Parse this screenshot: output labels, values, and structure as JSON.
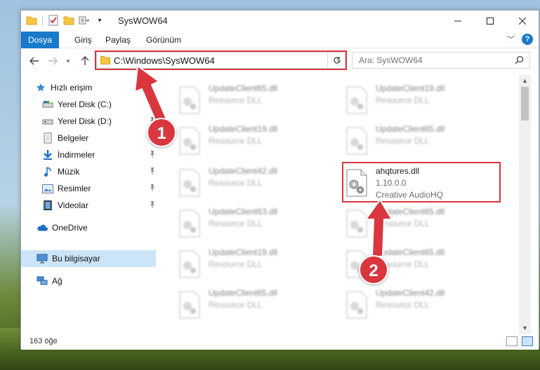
{
  "window": {
    "title": "SysWOW64"
  },
  "title_bar": {
    "qat_icons": [
      "folder-icon",
      "properties-icon",
      "new-folder-icon",
      "customize-icon"
    ]
  },
  "ribbon": {
    "tabs": [
      {
        "label": "Dosya",
        "active": true
      },
      {
        "label": "Giriş",
        "active": false
      },
      {
        "label": "Paylaş",
        "active": false
      },
      {
        "label": "Görünüm",
        "active": false
      }
    ],
    "accent_color": "#1979ca"
  },
  "navigation": {
    "address_path": "C:\\Windows\\SysWOW64",
    "search_placeholder": "Ara: SysWOW64"
  },
  "sidebar": {
    "items": [
      {
        "label": "Hızlı erişim",
        "icon": "star-icon"
      },
      {
        "label": "Yerel Disk (C:)",
        "icon": "drive-icon",
        "pinned": true
      },
      {
        "label": "Yerel Disk (D:)",
        "icon": "drive-icon",
        "pinned": true
      },
      {
        "label": "Belgeler",
        "icon": "documents-icon",
        "pinned": true
      },
      {
        "label": "İndirmeler",
        "icon": "download-icon",
        "pinned": true
      },
      {
        "label": "Müzik",
        "icon": "music-icon",
        "pinned": true
      },
      {
        "label": "Resimler",
        "icon": "pictures-icon",
        "pinned": true
      },
      {
        "label": "Videolar",
        "icon": "videos-icon",
        "pinned": true
      },
      {
        "label": "OneDrive",
        "icon": "cloud-icon"
      },
      {
        "label": "Bu bilgisayar",
        "icon": "computer-icon",
        "selected": true
      },
      {
        "label": "Ağ",
        "icon": "network-icon"
      }
    ]
  },
  "files": {
    "left_column": [
      {
        "name": "UpdateClient65.dll",
        "desc": "Resource DLL"
      },
      {
        "name": "UpdateClient19.dll",
        "desc": "Resource DLL"
      },
      {
        "name": "UpdateClient42.dll",
        "desc": "Resource DLL"
      },
      {
        "name": "UpdateClient63.dll",
        "desc": "Resource DLL"
      },
      {
        "name": "UpdateClient19.dll",
        "desc": "Resource DLL"
      },
      {
        "name": "UpdateClient65.dll",
        "desc": "Resource DLL"
      }
    ],
    "right_column": [
      {
        "name": "UpdateClient19.dll",
        "desc": "Resource DLL"
      },
      {
        "name": "UpdateClient65.dll",
        "desc": "Resource DLL"
      },
      {
        "name": "UpdateClient65.dll",
        "desc": "Resource DLL"
      },
      {
        "name": "UpdateClient65.dll",
        "desc": "Resource DLL"
      },
      {
        "name": "UpdateClient42.dll",
        "desc": "Resource DLL"
      }
    ],
    "highlighted": {
      "name": "ahqtures.dll",
      "version": "1.10.0.0",
      "company": "Creative AudioHQ"
    }
  },
  "status_bar": {
    "item_count": "163 öğe"
  },
  "callouts": [
    {
      "number": "1",
      "color": "#d9363e"
    },
    {
      "number": "2",
      "color": "#d9363e"
    }
  ]
}
